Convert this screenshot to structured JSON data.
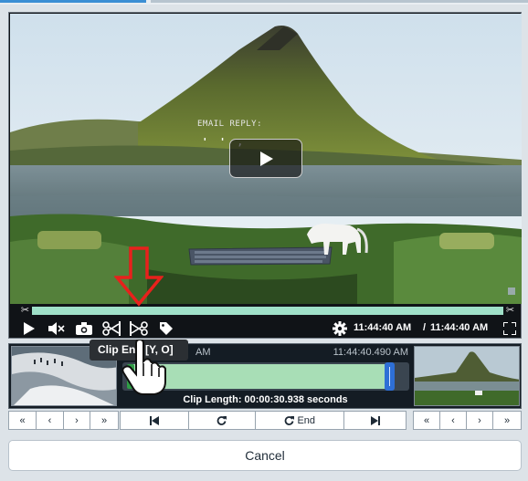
{
  "video": {
    "overlay_text": "EMAIL REPLY:",
    "overlay_ticks": "' ' ,",
    "current_time": "11:44:40 AM",
    "time_separator": "/",
    "duration_time": "11:44:40 AM"
  },
  "controls": {
    "play_icon": "play-icon",
    "mute_icon": "mute-icon",
    "snapshot_icon": "camera-icon",
    "clip_start_icon": "scissors-icon",
    "clip_end_icon": "scissors-end-icon",
    "tag_icon": "tag-icon",
    "settings_icon": "gear-icon",
    "fullscreen_icon": "fullscreen-icon"
  },
  "tooltip": "Clip End [Y, O]",
  "trim": {
    "start_time": "AM",
    "end_time": "11:44:40.490 AM",
    "clip_length": "Clip Length: 00:00:30.938 seconds"
  },
  "nav_left": [
    "«",
    "‹",
    "›",
    "»"
  ],
  "nav_right": [
    "«",
    "‹",
    "›",
    "»"
  ],
  "center_bar": {
    "go_start_icon": "skip-to-start-icon",
    "loop_icon": "refresh-icon",
    "end_label": "End",
    "go_end_icon": "skip-to-end-icon"
  },
  "cancel_label": "Cancel",
  "colors": {
    "progress": "#9fe0c8",
    "trim_fill": "#a8deb6",
    "handle_start": "#2f9e46",
    "handle_end": "#2e6fd6",
    "arrow": "#e8211c"
  }
}
